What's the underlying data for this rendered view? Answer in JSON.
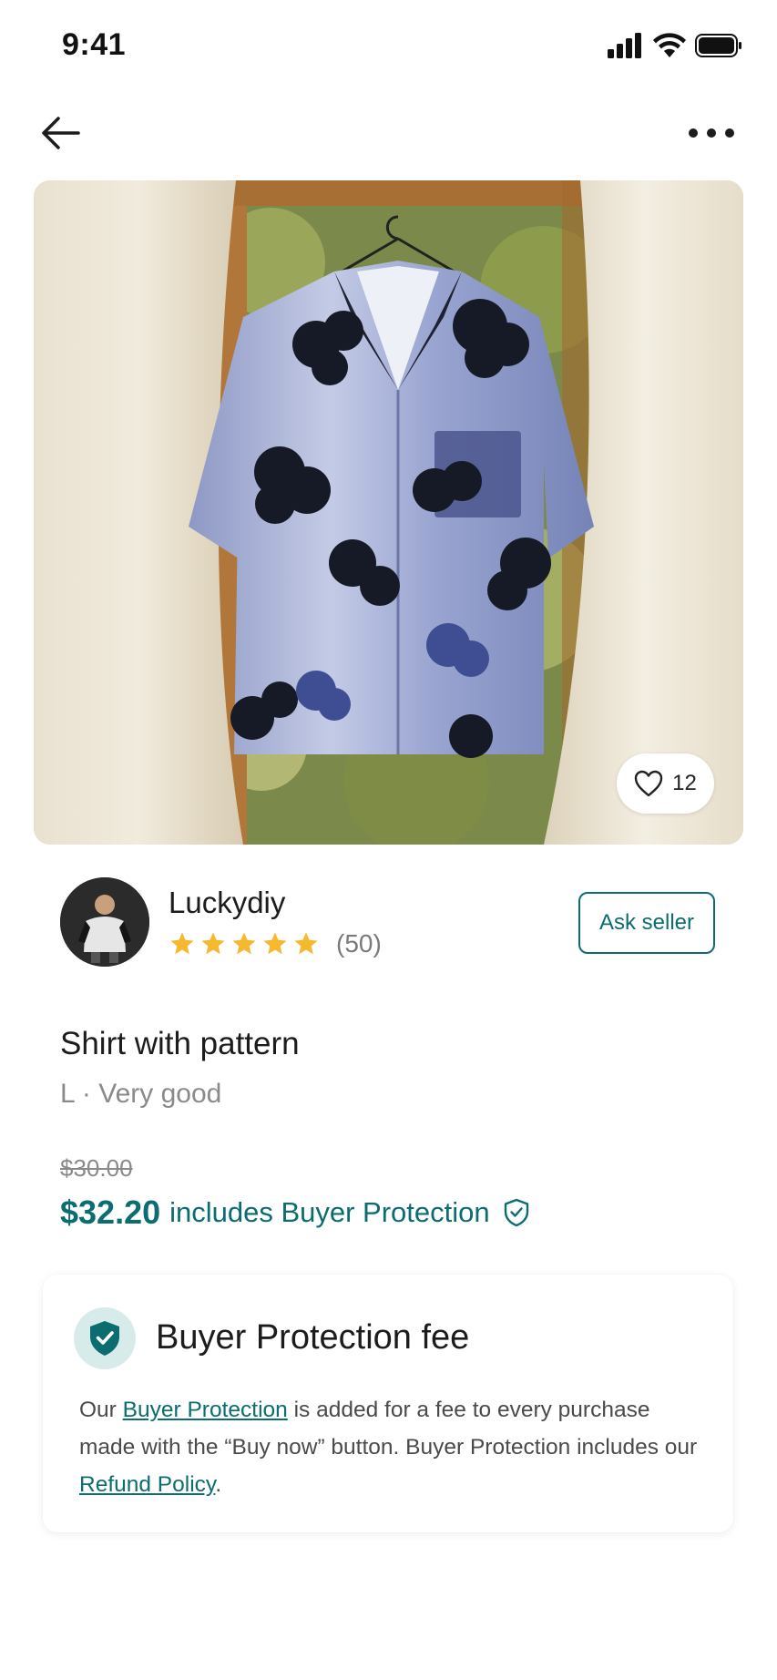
{
  "status_bar": {
    "time": "9:41"
  },
  "product": {
    "favorites_count": "12",
    "title": "Shirt with pattern",
    "meta": "L · Very good",
    "old_price": "$30.00",
    "price": "$32.20",
    "price_note": "includes Buyer Protection"
  },
  "seller": {
    "name": "Luckydiy",
    "rating_stars": 5,
    "rating_count": "(50)",
    "ask_label": "Ask seller"
  },
  "protection_card": {
    "title": "Buyer Protection fee",
    "body_part1": "Our ",
    "link1": "Buyer Protection",
    "body_part2": " is added for a fee to every purchase made with the “Buy now” button. Buyer Protection includes our ",
    "link2": "Refund Policy",
    "body_part3": "."
  },
  "colors": {
    "accent": "#0b6d70",
    "star": "#f5b82e",
    "muted_text": "#8a8a8a"
  },
  "icons": [
    "back-arrow-icon",
    "more-icon",
    "heart-icon",
    "star-icon",
    "shield-check-icon",
    "signal-icon",
    "wifi-icon",
    "battery-icon"
  ]
}
